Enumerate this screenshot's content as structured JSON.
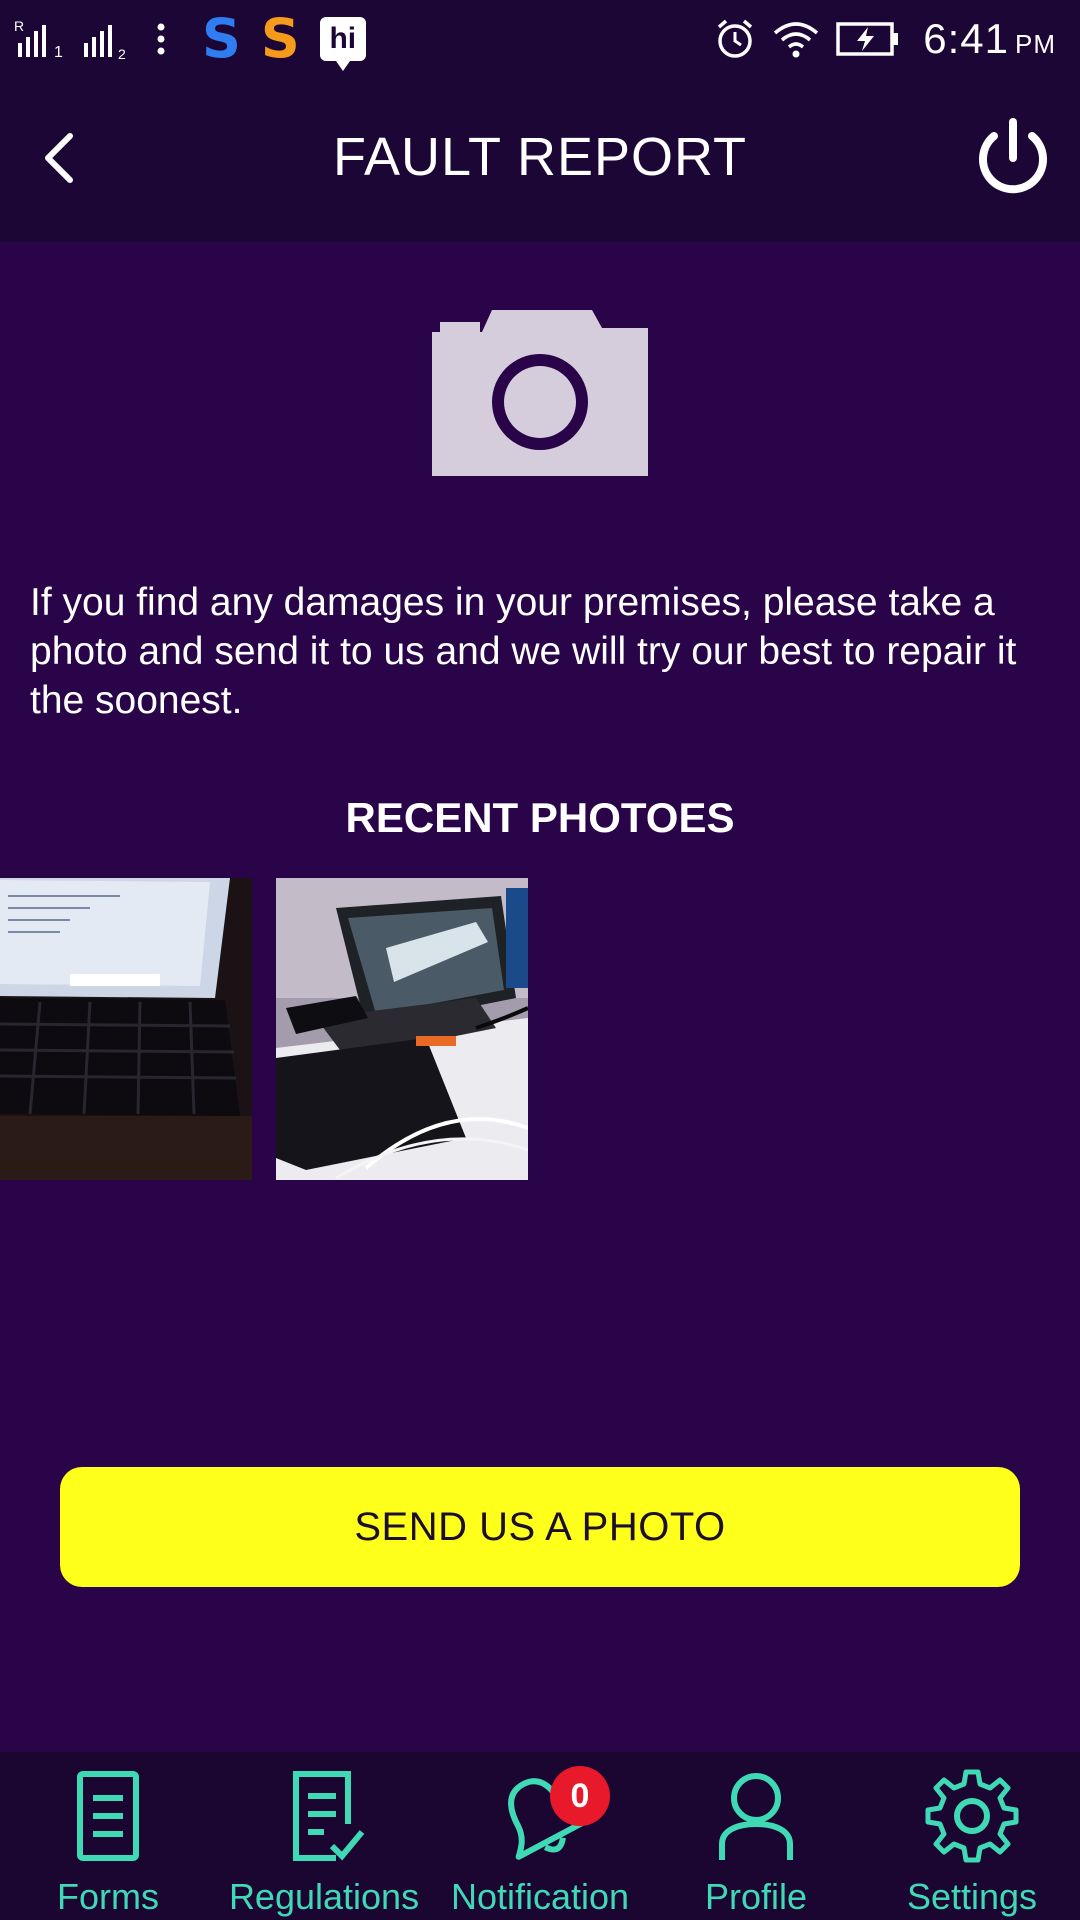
{
  "status_bar": {
    "sim1": "R",
    "sim1_index": "1",
    "sim2_index": "2",
    "app_icons": [
      "s-blue-app-icon",
      "s-orange-app-icon",
      "hi-app-icon"
    ],
    "app_s_letter": "S",
    "app_hi_label": "hi",
    "time": "6:41",
    "ampm": "PM"
  },
  "header": {
    "title": "FAULT REPORT",
    "back_icon": "chevron-left-icon",
    "power_icon": "power-icon"
  },
  "main": {
    "camera_icon": "camera-icon",
    "description": "If you find any damages in your premises, please take a photo and send it to us and we will try our best to repair it the soonest.",
    "recent_title": "RECENT PHOTOES",
    "photos_count": 2,
    "send_button": "SEND US A PHOTO"
  },
  "bottom_nav": {
    "items": [
      {
        "label": "Forms",
        "icon": "forms-icon"
      },
      {
        "label": "Regulations",
        "icon": "regulations-icon"
      },
      {
        "label": "Notification",
        "icon": "bell-icon",
        "badge": "0"
      },
      {
        "label": "Profile",
        "icon": "profile-icon"
      },
      {
        "label": "Settings",
        "icon": "gear-icon"
      }
    ]
  },
  "colors": {
    "background": "#290449",
    "header": "#1c0635",
    "accent_nav": "#3fd9b5",
    "button": "#ffff1c",
    "badge": "#e8192a"
  }
}
